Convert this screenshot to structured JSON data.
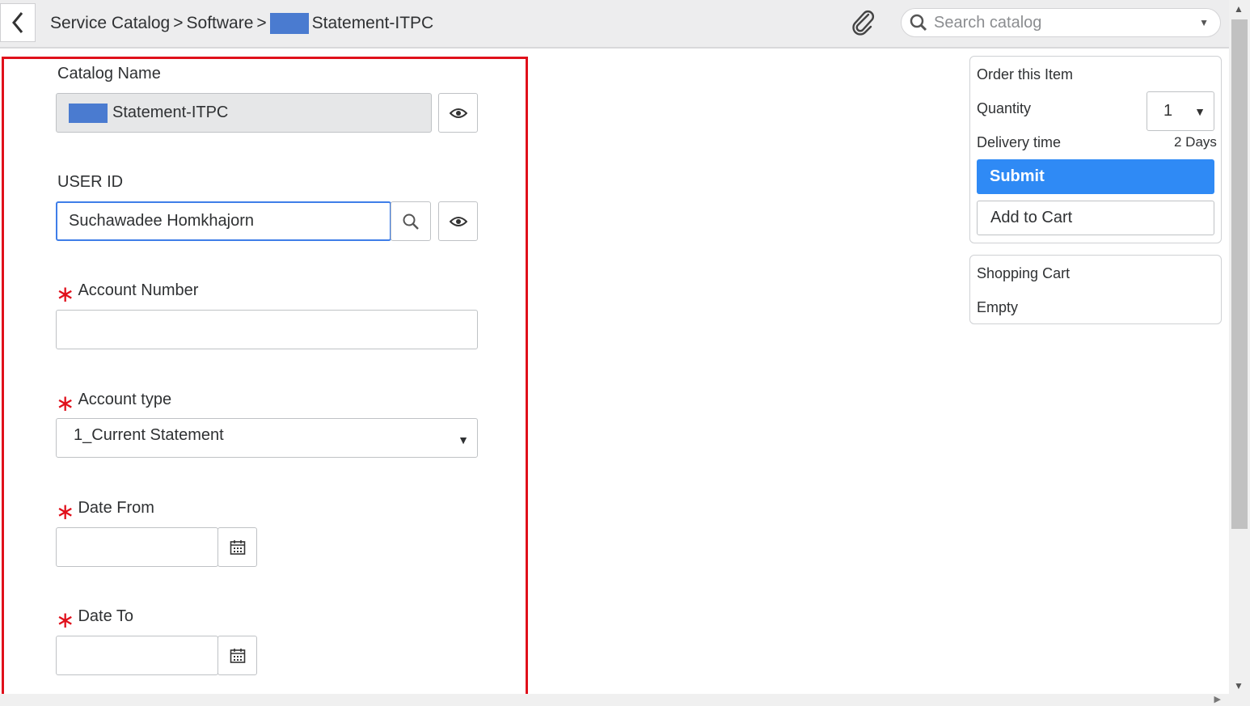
{
  "header": {
    "breadcrumb": [
      "Service Catalog",
      "Software",
      "Statement-ITPC"
    ],
    "separator": ">",
    "search_placeholder": "Search catalog"
  },
  "form": {
    "catalog_name": {
      "label": "Catalog Name",
      "value": "Statement-ITPC"
    },
    "user_id": {
      "label": "USER ID",
      "value": "Suchawadee Homkhajorn"
    },
    "account_number": {
      "label": "Account Number",
      "value": "",
      "required": true
    },
    "account_type": {
      "label": "Account type",
      "value": "1_Current Statement",
      "required": true
    },
    "date_from": {
      "label": "Date From",
      "value": "",
      "required": true
    },
    "date_to": {
      "label": "Date To",
      "value": "",
      "required": true
    },
    "required_mark": "∗"
  },
  "order": {
    "title": "Order this Item",
    "quantity_label": "Quantity",
    "quantity_value": "1",
    "delivery_label": "Delivery time",
    "delivery_value": "2 Days",
    "submit_label": "Submit",
    "add_to_cart_label": "Add to Cart"
  },
  "cart": {
    "title": "Shopping Cart",
    "status": "Empty"
  },
  "colors": {
    "accent": "#2f8af5",
    "required": "#e0101b",
    "highlight": "#e0101b",
    "redaction": "#4a7bd0"
  }
}
